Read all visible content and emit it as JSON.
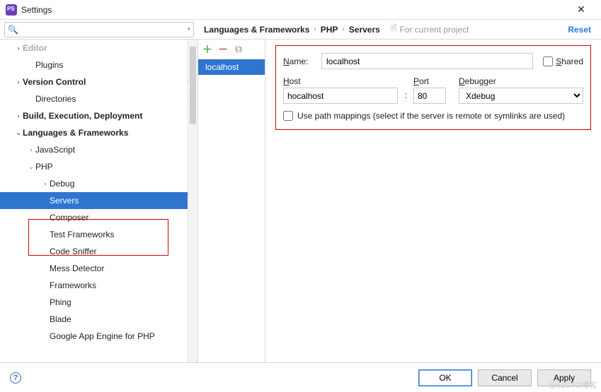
{
  "window": {
    "title": "Settings"
  },
  "search": {
    "placeholder": ""
  },
  "breadcrumb": {
    "parts": [
      "Languages & Frameworks",
      "PHP",
      "Servers"
    ],
    "note": "For current project",
    "reset": "Reset"
  },
  "tree": {
    "items": [
      {
        "label": "Editor",
        "level": "lvl1",
        "arrow": "›",
        "copy": false,
        "dim": true
      },
      {
        "label": "Plugins",
        "level": "lvl2",
        "arrow": "",
        "copy": false
      },
      {
        "label": "Version Control",
        "level": "lvl1",
        "arrow": "›",
        "copy": true
      },
      {
        "label": "Directories",
        "level": "lvl2",
        "arrow": "",
        "copy": true
      },
      {
        "label": "Build, Execution, Deployment",
        "level": "lvl1",
        "arrow": "›",
        "copy": false
      },
      {
        "label": "Languages & Frameworks",
        "level": "lvl1",
        "arrow": "⌄",
        "copy": false
      },
      {
        "label": "JavaScript",
        "level": "lvl2",
        "arrow": "›",
        "copy": true
      },
      {
        "label": "PHP",
        "level": "lvl2",
        "arrow": "⌄",
        "copy": true
      },
      {
        "label": "Debug",
        "level": "lvl3",
        "arrow": "›",
        "copy": true
      },
      {
        "label": "Servers",
        "level": "lvl3",
        "arrow": "",
        "copy": true,
        "selected": true
      },
      {
        "label": "Composer",
        "level": "lvl3",
        "arrow": "",
        "copy": true
      },
      {
        "label": "Test Frameworks",
        "level": "lvl3",
        "arrow": "",
        "copy": true
      },
      {
        "label": "Code Sniffer",
        "level": "lvl3",
        "arrow": "",
        "copy": true
      },
      {
        "label": "Mess Detector",
        "level": "lvl3",
        "arrow": "",
        "copy": true
      },
      {
        "label": "Frameworks",
        "level": "lvl3",
        "arrow": "",
        "copy": true
      },
      {
        "label": "Phing",
        "level": "lvl3",
        "arrow": "",
        "copy": true
      },
      {
        "label": "Blade",
        "level": "lvl3",
        "arrow": "",
        "copy": true
      },
      {
        "label": "Google App Engine for PHP",
        "level": "lvl3",
        "arrow": "",
        "copy": true
      }
    ]
  },
  "serverList": {
    "selected": "localhost"
  },
  "form": {
    "name_label": "Name:",
    "name_value": "localhost",
    "shared_label": "Shared",
    "host_label": "Host",
    "port_label": "Port",
    "debugger_label": "Debugger",
    "host_value": "hocalhost",
    "port_value": "80",
    "debugger_value": "Xdebug",
    "mapping_label": "Use path mappings (select if the server is remote or symlinks are used)"
  },
  "footer": {
    "ok": "OK",
    "cancel": "Cancel",
    "apply": "Apply"
  },
  "watermark": "@51CTO博客"
}
